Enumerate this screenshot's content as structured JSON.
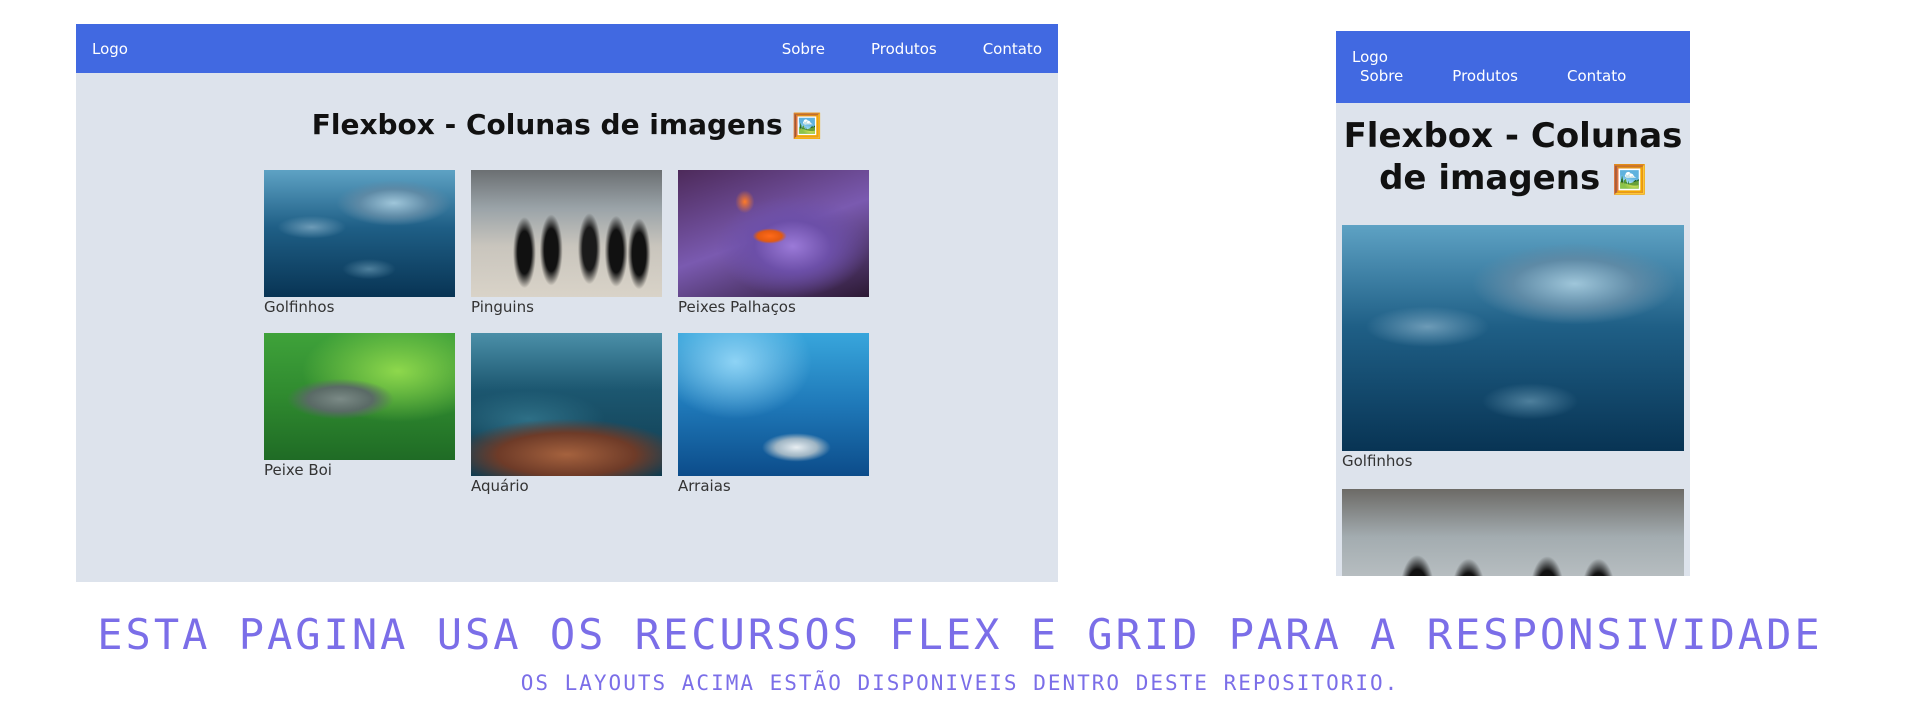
{
  "desktop": {
    "nav": {
      "logo": "Logo",
      "links": [
        "Sobre",
        "Produtos",
        "Contato"
      ]
    },
    "title": "Flexbox - Colunas de imagens",
    "title_emoji": "🖼️",
    "gallery": [
      {
        "caption": "Golfinhos",
        "image": "dolphins"
      },
      {
        "caption": "Pinguins",
        "image": "penguins"
      },
      {
        "caption": "Peixes Palhaços",
        "image": "clownfish"
      },
      {
        "caption": "Peixe Boi",
        "image": "manatee"
      },
      {
        "caption": "Aquário",
        "image": "aquarium"
      },
      {
        "caption": "Arraias",
        "image": "stingrays"
      }
    ]
  },
  "mobile": {
    "nav": {
      "logo": "Logo",
      "links": [
        "Sobre",
        "Produtos",
        "Contato"
      ]
    },
    "title": "Flexbox - Colunas de imagens",
    "title_emoji": "🖼️",
    "gallery": [
      {
        "caption": "Golfinhos",
        "image": "dolphins"
      },
      {
        "caption": "",
        "image": "penguins"
      }
    ]
  },
  "footer": {
    "headline": "Esta pagina usa os recursos flex e grid para a responsividade",
    "subline": "Os layouts acima estão disponiveis dentro deste repositorio."
  },
  "colors": {
    "nav": "#4169e1",
    "page_bg": "#dde3ec",
    "accent_text": "#7b6ee8"
  }
}
